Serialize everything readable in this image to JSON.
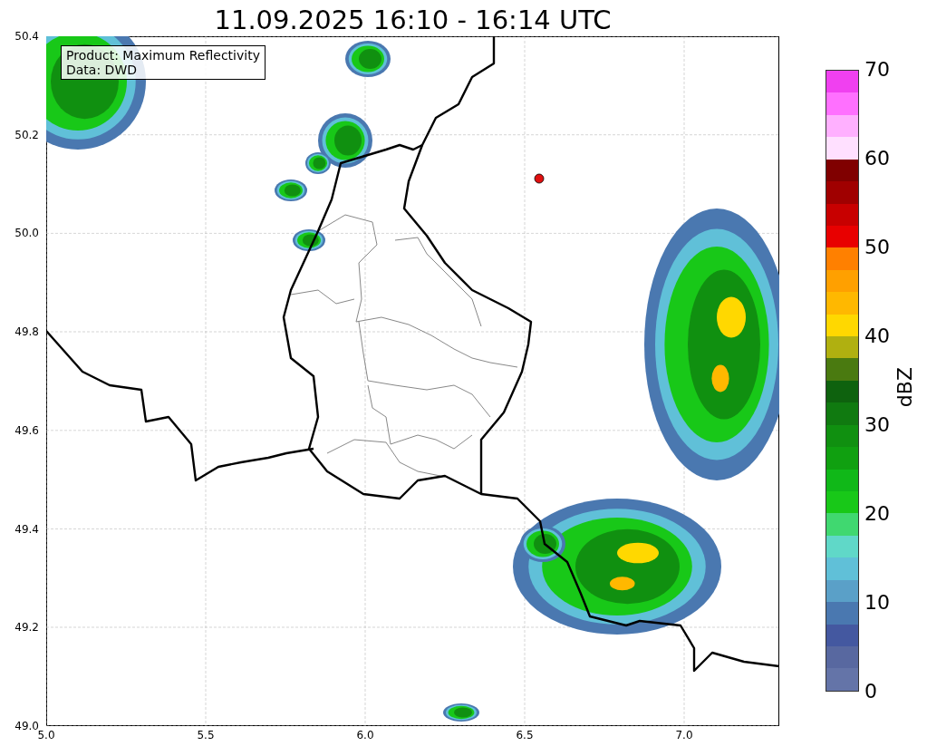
{
  "title": "11.09.2025 16:10 - 16:14 UTC",
  "info_box": {
    "lines": [
      "Product: Maximum Reflectivity",
      "Data: DWD"
    ]
  },
  "y_axis": {
    "ticks": [
      "50.4",
      "50.2",
      "50.0",
      "49.8",
      "49.6",
      "49.4",
      "49.2",
      "49.0"
    ]
  },
  "x_axis": {
    "ticks": [
      "5.0",
      "5.5",
      "6.0",
      "6.5",
      "7.0"
    ]
  },
  "colorbar": {
    "label": "dBZ",
    "ticks": [
      "70",
      "60",
      "50",
      "40",
      "30",
      "20",
      "10",
      "0"
    ],
    "bands": [
      {
        "color": "#f040f0"
      },
      {
        "color": "#ff70ff"
      },
      {
        "color": "#ffb0ff"
      },
      {
        "color": "#ffe0ff"
      },
      {
        "color": "#800000"
      },
      {
        "color": "#a00000"
      },
      {
        "color": "#c80000"
      },
      {
        "color": "#e80000"
      },
      {
        "color": "#ff8000"
      },
      {
        "color": "#ffa000"
      },
      {
        "color": "#ffb800"
      },
      {
        "color": "#ffd800"
      },
      {
        "color": "#b0b010"
      },
      {
        "color": "#4a7a10"
      },
      {
        "color": "#0e620e"
      },
      {
        "color": "#107a10"
      },
      {
        "color": "#109010"
      },
      {
        "color": "#10a010"
      },
      {
        "color": "#10b818"
      },
      {
        "color": "#18c818"
      },
      {
        "color": "#40d870"
      },
      {
        "color": "#60d8c8"
      },
      {
        "color": "#60c0d8"
      },
      {
        "color": "#5aa0c8"
      },
      {
        "color": "#4a78b0"
      },
      {
        "color": "#4458a0"
      },
      {
        "color": "#5868a0"
      },
      {
        "color": "#6474a8"
      }
    ]
  }
}
